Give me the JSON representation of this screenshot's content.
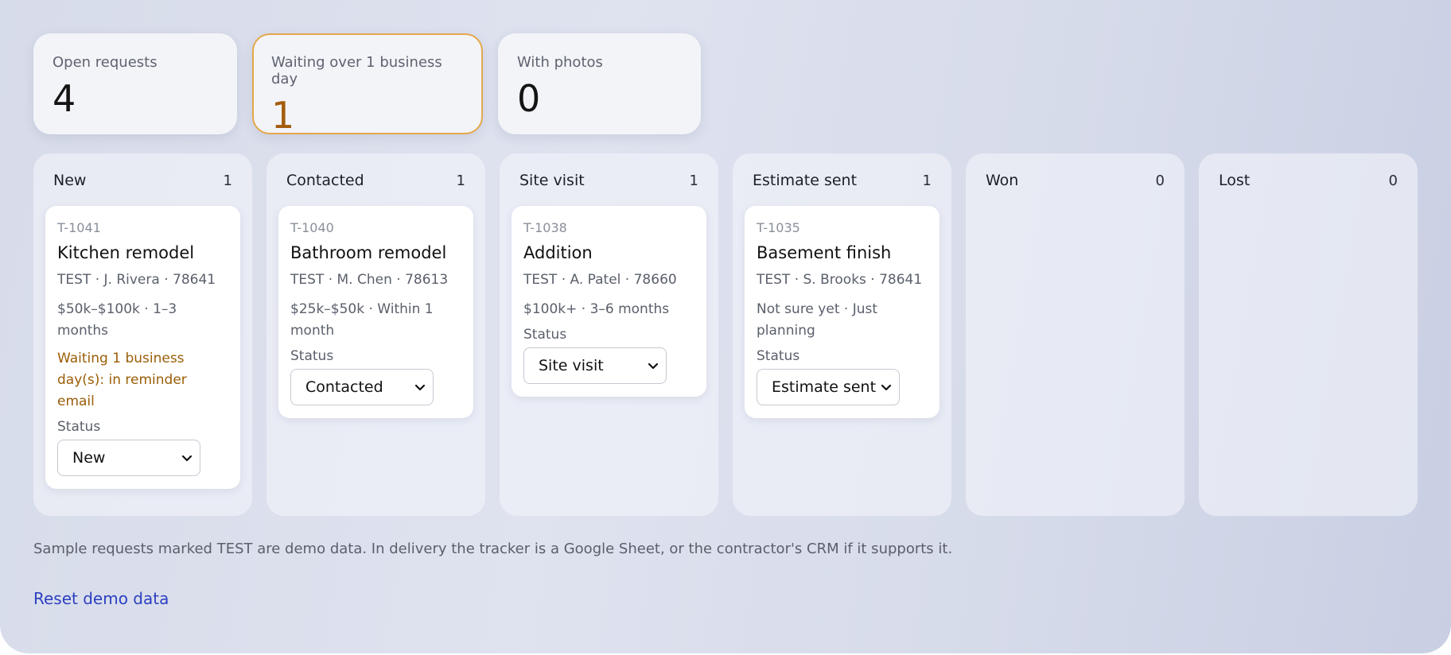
{
  "stats": [
    {
      "label": "Open requests",
      "value": "4"
    },
    {
      "label": "Waiting over 1 business day",
      "value": "1"
    },
    {
      "label": "With photos",
      "value": "0"
    }
  ],
  "columns": [
    {
      "title": "New",
      "count": "1"
    },
    {
      "title": "Contacted",
      "count": "1"
    },
    {
      "title": "Site visit",
      "count": "1"
    },
    {
      "title": "Estimate sent",
      "count": "1"
    },
    {
      "title": "Won",
      "count": "0"
    },
    {
      "title": "Lost",
      "count": "0"
    }
  ],
  "cards": [
    {
      "id": "T-1041",
      "title": "Kitchen remodel",
      "contact": "TEST · J. Rivera · 78641",
      "budget": "$50k–$100k · 1–3 months",
      "waiting": "Waiting 1 business day(s): in reminder email",
      "status_label": "Status",
      "status": "New"
    },
    {
      "id": "T-1040",
      "title": "Bathroom remodel",
      "contact": "TEST · M. Chen · 78613",
      "budget": "$25k–$50k · Within 1 month",
      "status_label": "Status",
      "status": "Contacted"
    },
    {
      "id": "T-1038",
      "title": "Addition",
      "contact": "TEST · A. Patel · 78660",
      "budget": "$100k+ · 3–6 months",
      "status_label": "Status",
      "status": "Site visit"
    },
    {
      "id": "T-1035",
      "title": "Basement finish",
      "contact": "TEST · S. Brooks · 78641",
      "budget": "Not sure yet · Just planning",
      "status_label": "Status",
      "status": "Estimate sent"
    }
  ],
  "footer": {
    "note": "Sample requests marked TEST are demo data. In delivery the tracker is a Google Sheet, or the contractor's CRM if it supports it.",
    "reset_label": "Reset demo data"
  },
  "colors": {
    "warning": "#a35d0c",
    "warning_border": "#e4a84c",
    "link": "#2b3fc0"
  },
  "icons": {
    "select_arrow": "chevron-down-icon"
  }
}
